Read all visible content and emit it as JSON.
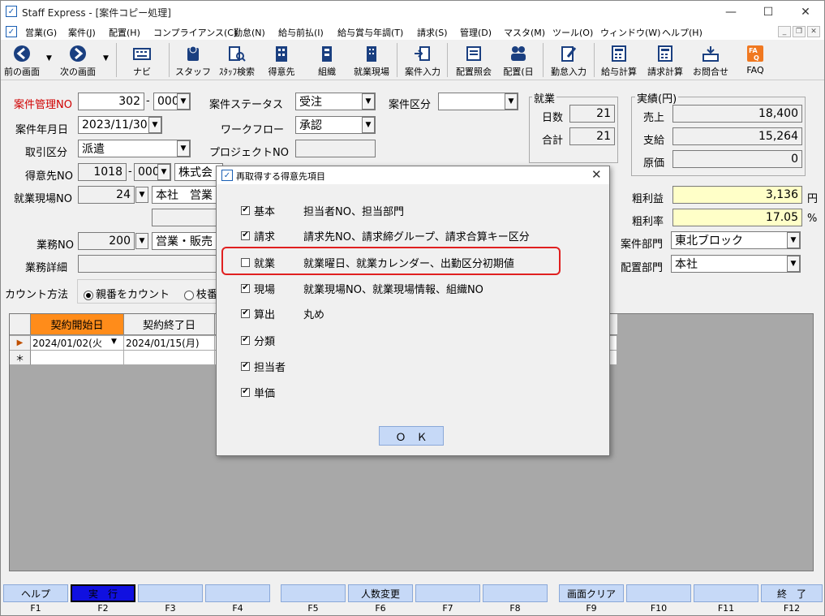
{
  "window": {
    "title": "Staff Express - [案件コピー処理]"
  },
  "menu": [
    "営業(G)",
    "案件(J)",
    "配置(H)",
    "コンプライアンス(C)",
    "勤怠(N)",
    "給与前払(I)",
    "給与賞与年調(T)",
    "請求(S)",
    "管理(D)",
    "マスタ(M)",
    "ツール(O)",
    "ウィンドウ(W)",
    "ヘルプ(H)"
  ],
  "toolbar": [
    "前の画面",
    "次の画面",
    "ナビ",
    "スタッフ",
    "ｽﾀｯﾌ検索",
    "得意先",
    "組織",
    "就業現場",
    "案件入力",
    "配置照会",
    "配置(日",
    "勤怠入力",
    "給与計算",
    "請求計算",
    "お問合せ",
    "FAQ"
  ],
  "form": {
    "case_no_label": "案件管理NO",
    "case_no": "302",
    "case_no_sep": "-",
    "case_branch": "000",
    "status_label": "案件ステータス",
    "status": "受注",
    "category_label": "案件区分",
    "category": "",
    "ym_label": "案件年月日",
    "ym": "2023/11/30",
    "workflow_label": "ワークフロー",
    "workflow": "承認",
    "deal_label": "取引区分",
    "deal": "派遣",
    "project_label": "プロジェクトNO",
    "project": "",
    "client_label": "得意先NO",
    "client_no": "1018",
    "client_sep": "-",
    "client_branch": "000",
    "client_name": "株式会",
    "site_label": "就業現場NO",
    "site_no": "24",
    "site_name": "本社　営業",
    "job_label": "業務NO",
    "job_no": "200",
    "job_name": "営業・販売",
    "detail_label": "業務詳細",
    "count_label": "カウント方法",
    "count_opt1": "親番をカウント",
    "count_opt2": "枝番"
  },
  "work": {
    "group": "就業",
    "days_label": "日数",
    "days": "21",
    "total_label": "合計",
    "total": "21"
  },
  "results": {
    "group": "実績(円)",
    "sales_label": "売上",
    "sales": "18,400",
    "pay_label": "支給",
    "pay": "15,264",
    "cost_label": "原価",
    "cost": "0",
    "profit_label": "粗利益",
    "profit": "3,136",
    "profit_unit": "円",
    "rate_label": "粗利率",
    "rate": "17.05",
    "rate_unit": "%",
    "dept_label": "案件部門",
    "dept": "東北ブロック",
    "assign_label": "配置部門",
    "assign": "本社"
  },
  "grid": {
    "h1": "契約開始日",
    "h2": "契約終了日",
    "r1c1": "2024/01/02(火",
    "r1c2": "2024/01/15(月)",
    "new_marker": "＊"
  },
  "dialog": {
    "title": "再取得する得意先項目",
    "items": [
      {
        "label": "基本",
        "desc": "担当者NO、担当部門",
        "checked": true
      },
      {
        "label": "請求",
        "desc": "請求先NO、請求締グループ、請求合算キー区分",
        "checked": true
      },
      {
        "label": "就業",
        "desc": "就業曜日、就業カレンダー、出勤区分初期値",
        "checked": false
      },
      {
        "label": "現場",
        "desc": "就業現場NO、就業現場情報、組織NO",
        "checked": true
      },
      {
        "label": "算出",
        "desc": "丸め",
        "checked": true
      },
      {
        "label": "分類",
        "desc": "",
        "checked": true
      },
      {
        "label": "担当者",
        "desc": "",
        "checked": true
      },
      {
        "label": "単価",
        "desc": "",
        "checked": true
      }
    ],
    "ok": "Ｏ　Ｋ"
  },
  "fkeys": [
    {
      "label": "ヘルプ",
      "key": "F1"
    },
    {
      "label": "実　行",
      "key": "F2"
    },
    {
      "label": "",
      "key": "F3"
    },
    {
      "label": "",
      "key": "F4"
    },
    {
      "label": "",
      "key": "F5"
    },
    {
      "label": "人数変更",
      "key": "F6"
    },
    {
      "label": "",
      "key": "F7"
    },
    {
      "label": "",
      "key": "F8"
    },
    {
      "label": "画面クリア",
      "key": "F9"
    },
    {
      "label": "",
      "key": "F10"
    },
    {
      "label": "",
      "key": "F11"
    },
    {
      "label": "終　了",
      "key": "F12"
    }
  ],
  "colors": {
    "accent": "#c6d9f7",
    "highlight": "#e02020",
    "active_fkey": "#1010e0",
    "grid_header_active": "#ff8c1a"
  }
}
